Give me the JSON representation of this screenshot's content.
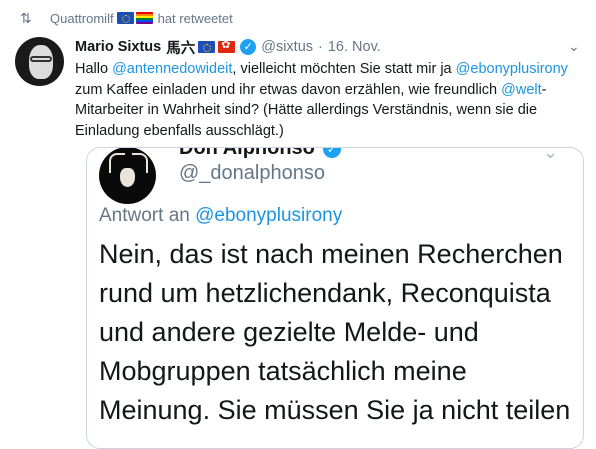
{
  "retweet": {
    "user": "Quattromilf",
    "suffix": "hat retweetet"
  },
  "tweet": {
    "name": "Mario Sixtus",
    "cjk": "馬六",
    "handle": "@sixtus",
    "separator": "·",
    "date": "16. Nov.",
    "parts": [
      {
        "t": "Hallo ",
        "m": false
      },
      {
        "t": "@antennedowideit",
        "m": true
      },
      {
        "t": ", vielleicht möchten Sie statt mir ja ",
        "m": false
      },
      {
        "t": "@ebonyplusirony",
        "m": true
      },
      {
        "t": " zum Kaffee einladen und ihr etwas davon erzählen, wie freundlich ",
        "m": false
      },
      {
        "t": "@welt",
        "m": true
      },
      {
        "t": "-Mitarbeiter in Wahrheit sind? (Hätte allerdings Verständnis, wenn sie die Einladung ebenfalls ausschlägt.)",
        "m": false
      }
    ]
  },
  "quoted": {
    "name": "Don Alphonso",
    "handle": "@_donalphonso",
    "reply_prefix": "Antwort an",
    "reply_to": "@ebonyplusirony",
    "text": "Nein, das ist nach meinen Recherchen rund um hetzlichendank, Reconquista und andere gezielte Melde- und Mobgruppen tatsächlich meine Meinung. Sie müssen Sie ja nicht teilen"
  },
  "icons": {
    "retweet": "retweet-icon",
    "verified": "verified-badge-icon",
    "more": "chevron-down-icon"
  },
  "colors": {
    "link": "#1b95e0",
    "verified": "#1da1f2",
    "muted": "#657786"
  }
}
